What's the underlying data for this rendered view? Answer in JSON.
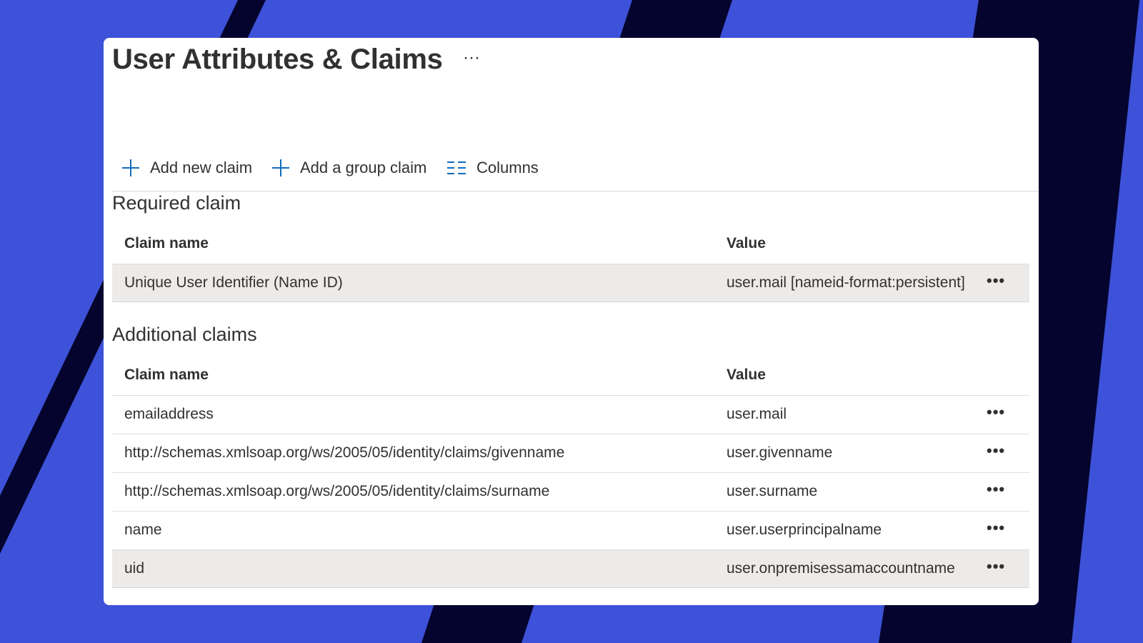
{
  "page": {
    "title": "User Attributes & Claims",
    "more_label": "···"
  },
  "toolbar": {
    "add_new_claim": "Add new claim",
    "add_group_claim": "Add a group claim",
    "columns": "Columns"
  },
  "required": {
    "section_title": "Required claim",
    "col_name": "Claim name",
    "col_value": "Value",
    "rows": [
      {
        "name": "Unique User Identifier (Name ID)",
        "value": "user.mail [nameid-format:persistent]",
        "more": "•••"
      }
    ]
  },
  "additional": {
    "section_title": "Additional claims",
    "col_name": "Claim name",
    "col_value": "Value",
    "rows": [
      {
        "name": "emailaddress",
        "value": "user.mail",
        "more": "•••"
      },
      {
        "name": "http://schemas.xmlsoap.org/ws/2005/05/identity/claims/givenname",
        "value": "user.givenname",
        "more": "•••"
      },
      {
        "name": "http://schemas.xmlsoap.org/ws/2005/05/identity/claims/surname",
        "value": "user.surname",
        "more": "•••"
      },
      {
        "name": "name",
        "value": "user.userprincipalname",
        "more": "•••"
      },
      {
        "name": "uid",
        "value": "user.onpremisessamaccountname",
        "more": "•••"
      }
    ]
  },
  "colors": {
    "background_blue": "#3d52d8",
    "stripe_navy": "#04042e",
    "accent_icon": "#0f6cbd",
    "row_highlight": "#edebe9"
  },
  "icons": {
    "add": "plus-icon",
    "columns": "columns-icon",
    "more": "more-horizontal-icon"
  }
}
